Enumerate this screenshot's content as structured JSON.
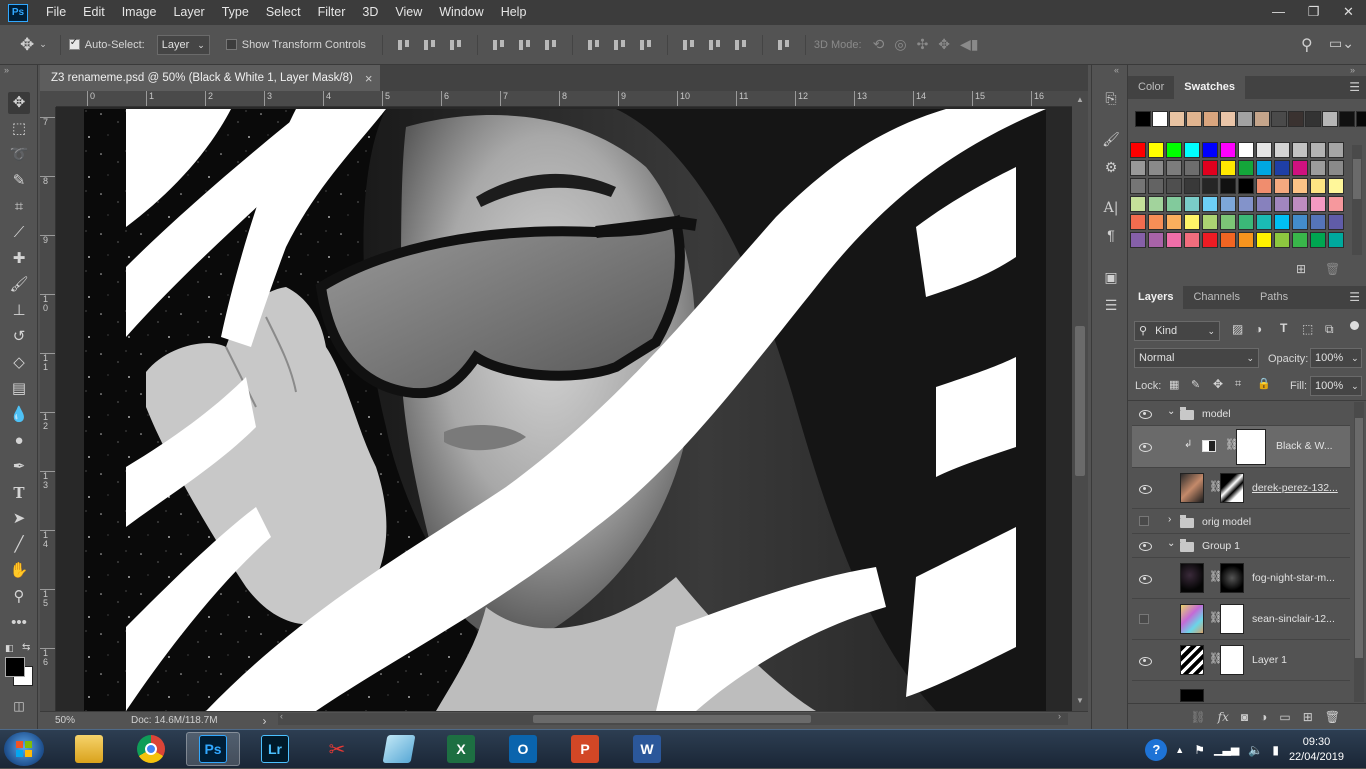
{
  "menubar": {
    "logo": "Ps",
    "items": [
      "File",
      "Edit",
      "Image",
      "Layer",
      "Type",
      "Select",
      "Filter",
      "3D",
      "View",
      "Window",
      "Help"
    ],
    "window_controls": [
      "—",
      "❐",
      "✕"
    ]
  },
  "options": {
    "auto_select_label": "Auto-Select:",
    "auto_select_target": "Layer",
    "show_transform_label": "Show Transform Controls",
    "mode_3d_label": "3D Mode:"
  },
  "document": {
    "tab_title": "Z3 renameme.psd @ 50% (Black & White 1, Layer Mask/8)",
    "close_glyph": "×",
    "ruler_top": [
      "0",
      "1",
      "2",
      "3",
      "4",
      "5",
      "6",
      "7",
      "8",
      "9",
      "10",
      "11",
      "12",
      "13",
      "14",
      "15",
      "16"
    ],
    "ruler_left": [
      "7",
      "8",
      "9",
      "1\n0",
      "1\n1",
      "1\n2",
      "1\n3",
      "1\n4",
      "1\n5",
      "1\n6"
    ],
    "zoom": "50%",
    "doc_size": "Doc: 14.6M/118.7M"
  },
  "color_panel": {
    "tabs": [
      "Color",
      "Swatches"
    ],
    "active_tab": "Swatches",
    "top_swatches": [
      "#000000",
      "#ffffff",
      "#e8c3a2",
      "#e0b48f",
      "#d9a57e",
      "#eac5a8",
      "#a2a2a2",
      "#c5a58b",
      "#4a4a4a",
      "#3a3230",
      "#333333",
      "#b7b7b7",
      "#111111",
      "#080808"
    ],
    "grid_swatches": [
      [
        "#ff0000",
        "#ffff00",
        "#00ff00",
        "#00ffff",
        "#0000ff",
        "#ff00ff",
        "#ffffff",
        "#e6e6e6",
        "#d2d2d2",
        "#c3c3c3",
        "#b3b3b3",
        "#a5a5a5"
      ],
      [
        "#999999",
        "#8a8a8a",
        "#7c7c7c",
        "#6d6d6d",
        "#e0001e",
        "#ffe800",
        "#14a63a",
        "#00a7e1",
        "#1f3fa6",
        "#cf117f",
        "#9c9c9c",
        "#8a8a8a"
      ],
      [
        "#757575",
        "#636363",
        "#4f4f4f",
        "#393939",
        "#262626",
        "#111111",
        "#000000",
        "#f08d6e",
        "#f5a97f",
        "#fcc286",
        "#fde483",
        "#fff79a"
      ],
      [
        "#c5e09a",
        "#a2d39c",
        "#82ca9c",
        "#7accc8",
        "#6dcff6",
        "#7da7d9",
        "#8393ca",
        "#8781bd",
        "#a186be",
        "#bd8cbf",
        "#f49ac2",
        "#f6989d"
      ],
      [
        "#f26c4f",
        "#f68e56",
        "#fbaf5d",
        "#fff467",
        "#acd372",
        "#7cc576",
        "#3bb878",
        "#1abbb4",
        "#00bff3",
        "#438ccb",
        "#5574b9",
        "#605ca8"
      ],
      [
        "#8560a8",
        "#a863a8",
        "#f06ea9",
        "#f26d7d",
        "#ed1c24",
        "#f26522",
        "#f7941d",
        "#fff200",
        "#8dc63f",
        "#39b54a",
        "#00a651",
        "#00a99d"
      ]
    ]
  },
  "layers_panel": {
    "tabs": [
      "Layers",
      "Channels",
      "Paths"
    ],
    "active_tab": "Layers",
    "filter_kind": "Kind",
    "blend_mode": "Normal",
    "opacity_label": "Opacity:",
    "opacity_value": "100%",
    "lock_label": "Lock:",
    "fill_label": "Fill:",
    "fill_value": "100%",
    "layers": [
      {
        "name": "model",
        "type": "group",
        "visible": true,
        "expanded": true,
        "indent": 0
      },
      {
        "name": "Black & W...",
        "type": "adjustment",
        "visible": true,
        "selected": true,
        "indent": 1
      },
      {
        "name": "derek-perez-132...",
        "type": "image",
        "visible": true,
        "indent": 1
      },
      {
        "name": "orig model",
        "type": "group",
        "visible": false,
        "expanded": false,
        "indent": 0
      },
      {
        "name": "Group 1",
        "type": "group",
        "visible": true,
        "expanded": true,
        "indent": 0
      },
      {
        "name": "fog-night-star-m...",
        "type": "image",
        "visible": true,
        "indent": 1
      },
      {
        "name": "sean-sinclair-12...",
        "type": "image",
        "visible": false,
        "indent": 1
      },
      {
        "name": "Layer 1",
        "type": "image",
        "visible": true,
        "indent": 1
      }
    ],
    "footer_icons": [
      "link-icon",
      "fx-icon",
      "mask-icon",
      "adjustment-icon",
      "folder-icon",
      "new-layer-icon",
      "trash-icon"
    ],
    "fx_label": "fx"
  },
  "taskbar": {
    "apps": [
      "Explorer",
      "Chrome",
      "Photoshop",
      "Lightroom",
      "Snipping Tool",
      "Notepad",
      "Excel",
      "Outlook",
      "PowerPoint",
      "Word"
    ],
    "app_glyphs": [
      "",
      "",
      "Ps",
      "Lr",
      "✂",
      "",
      "X",
      "O",
      "P",
      "W"
    ],
    "time": "09:30",
    "date": "22/04/2019"
  }
}
